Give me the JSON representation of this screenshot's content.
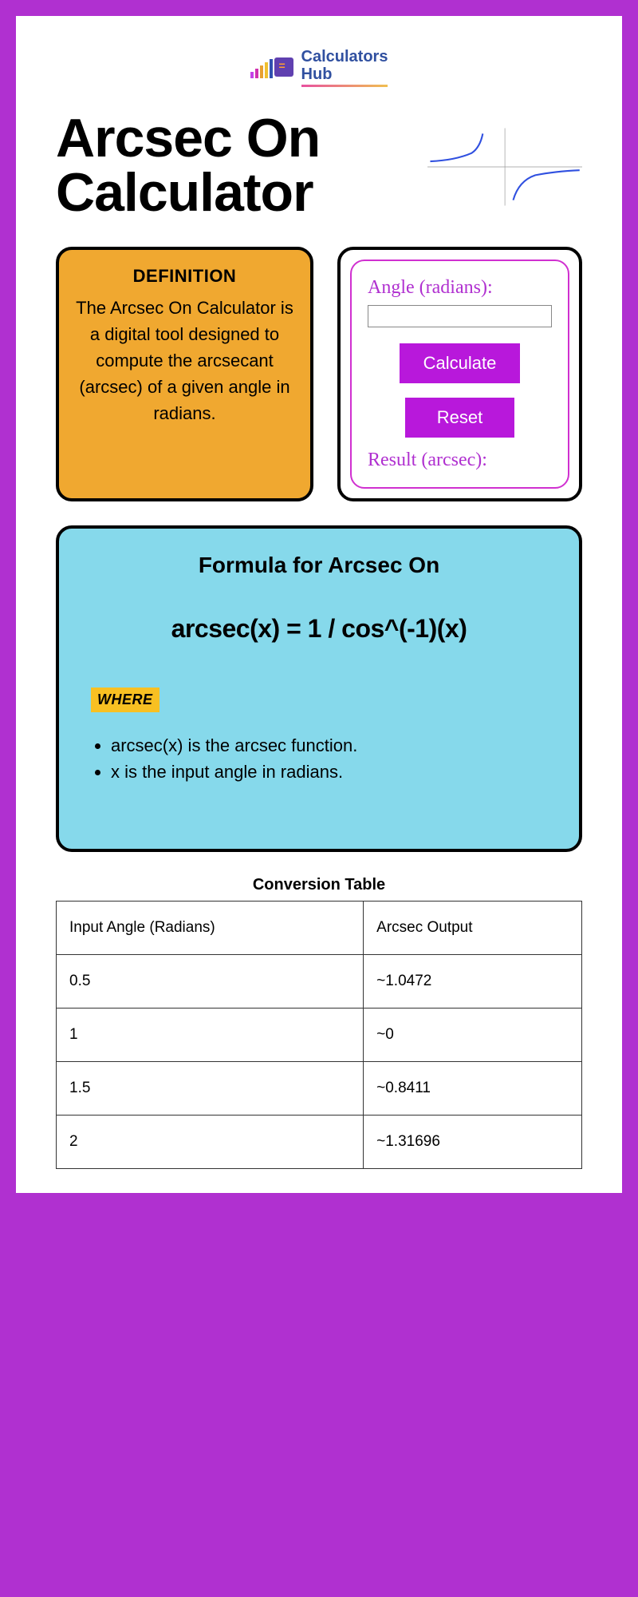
{
  "logo": {
    "line1": "Calculators",
    "line2": "Hub"
  },
  "title": "Arcsec On Calculator",
  "definition": {
    "heading": "DEFINITION",
    "text": "The Arcsec On Calculator is a digital tool designed to compute the arcsecant (arcsec) of a given angle in radians."
  },
  "calculator": {
    "input_label": "Angle (radians):",
    "calculate_label": "Calculate",
    "reset_label": "Reset",
    "result_label": "Result (arcsec):"
  },
  "formula": {
    "heading": "Formula for Arcsec On",
    "expression": "arcsec(x) = 1 / cos^(-1)(x)",
    "where_label": "WHERE",
    "where_items": [
      "arcsec(x) is the arcsec function.",
      "x is the input angle in radians."
    ]
  },
  "table": {
    "title": "Conversion Table",
    "headers": [
      "Input Angle (Radians)",
      "Arcsec Output"
    ],
    "rows": [
      [
        "0.5",
        "~1.0472"
      ],
      [
        "1",
        "~0"
      ],
      [
        "1.5",
        "~0.8411"
      ],
      [
        "2",
        "~1.31696"
      ]
    ]
  },
  "chart_data": {
    "type": "table",
    "title": "Conversion Table",
    "categories": [
      "Input Angle (Radians)",
      "Arcsec Output"
    ],
    "rows": [
      {
        "input": 0.5,
        "output": 1.0472
      },
      {
        "input": 1,
        "output": 0
      },
      {
        "input": 1.5,
        "output": 0.8411
      },
      {
        "input": 2,
        "output": 1.31696
      }
    ]
  }
}
